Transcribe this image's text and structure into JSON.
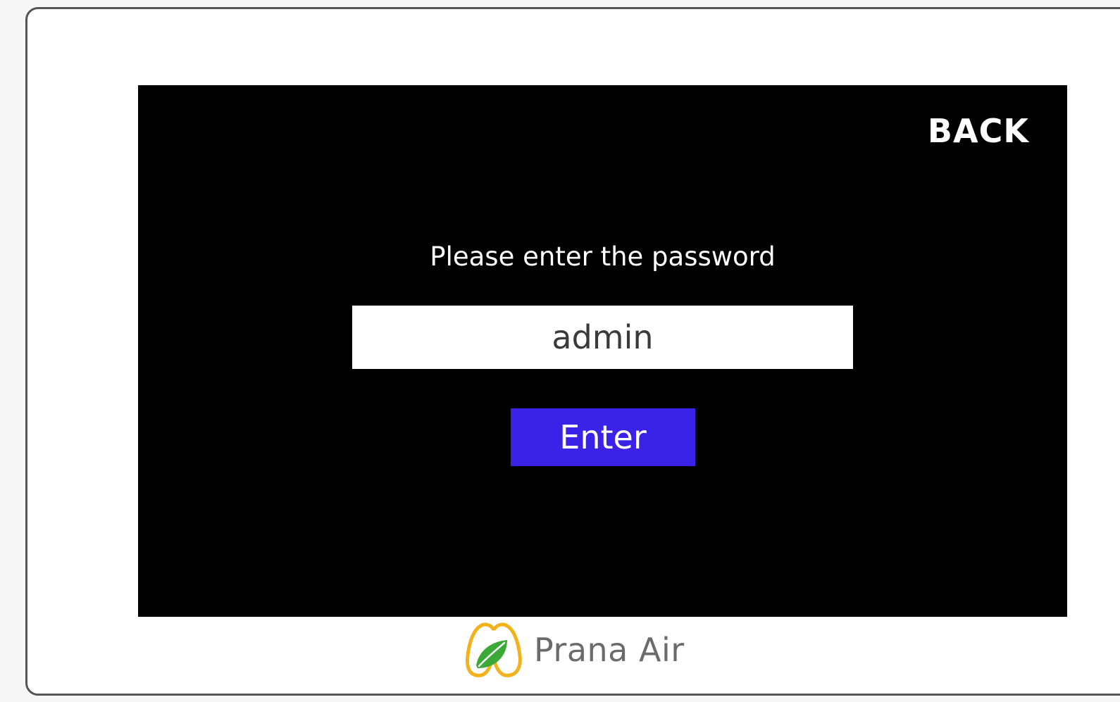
{
  "screen": {
    "back_label": "BACK",
    "prompt": "Please enter the password",
    "password_value": "admin",
    "enter_label": "Enter"
  },
  "brand": {
    "name": "Prana Air",
    "logo_icon": "lungs-leaf-logo"
  },
  "colors": {
    "screen_bg": "#000000",
    "enter_button": "#3a22e6",
    "logo_outline": "#f3b21a",
    "logo_leaf": "#3aa935"
  }
}
